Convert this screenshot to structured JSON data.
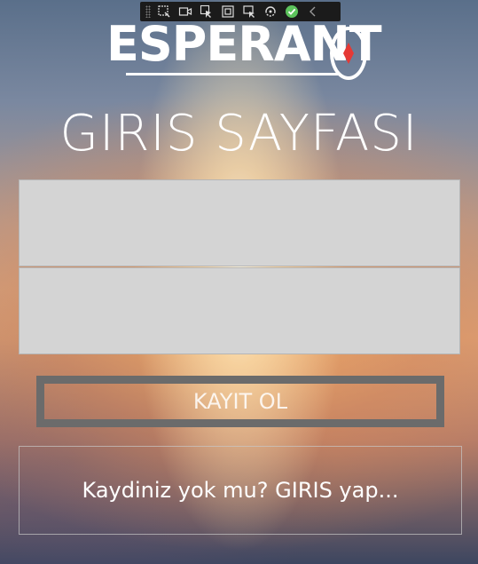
{
  "app": {
    "logo_text": "ESPERANT",
    "title": "GIRIS SAYFASI"
  },
  "form": {
    "username_value": "",
    "password_value": "",
    "register_label": "KAYIT OL",
    "login_link_label": "Kaydiniz yok mu? GIRIS yap..."
  },
  "toolbar": {
    "icons": [
      "select-element-icon",
      "video-icon",
      "pointer-icon",
      "frame-icon",
      "layout-icon",
      "hot-reload-icon",
      "check-icon",
      "collapse-chevron-icon"
    ]
  },
  "colors": {
    "input_bg": "#d4d4d4",
    "button_border": "#6b6b6b",
    "logo_drop": "#e53935"
  }
}
